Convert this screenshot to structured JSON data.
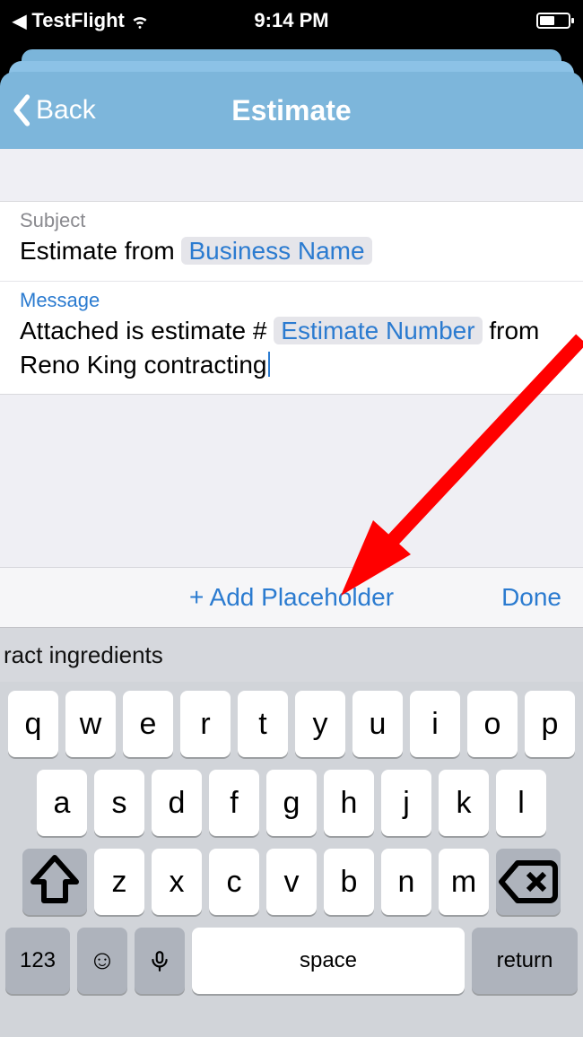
{
  "statusbar": {
    "back_app": "TestFlight",
    "time": "9:14 PM"
  },
  "nav": {
    "back_label": "Back",
    "title": "Estimate"
  },
  "form": {
    "subject": {
      "label": "Subject",
      "prefix": "Estimate from ",
      "token": "Business Name"
    },
    "message": {
      "label": "Message",
      "prefix": "Attached is estimate # ",
      "token": "Estimate Number",
      "suffix": " from Reno King contracting"
    }
  },
  "toolbar": {
    "add_placeholder": "+ Add Placeholder",
    "done": "Done"
  },
  "suggestions": {
    "item1": "ract ingredients"
  },
  "keyboard": {
    "row1": [
      "q",
      "w",
      "e",
      "r",
      "t",
      "y",
      "u",
      "i",
      "o",
      "p"
    ],
    "row2": [
      "a",
      "s",
      "d",
      "f",
      "g",
      "h",
      "j",
      "k",
      "l"
    ],
    "row3": [
      "z",
      "x",
      "c",
      "v",
      "b",
      "n",
      "m"
    ],
    "num_label": "123",
    "space_label": "space",
    "return_label": "return"
  }
}
